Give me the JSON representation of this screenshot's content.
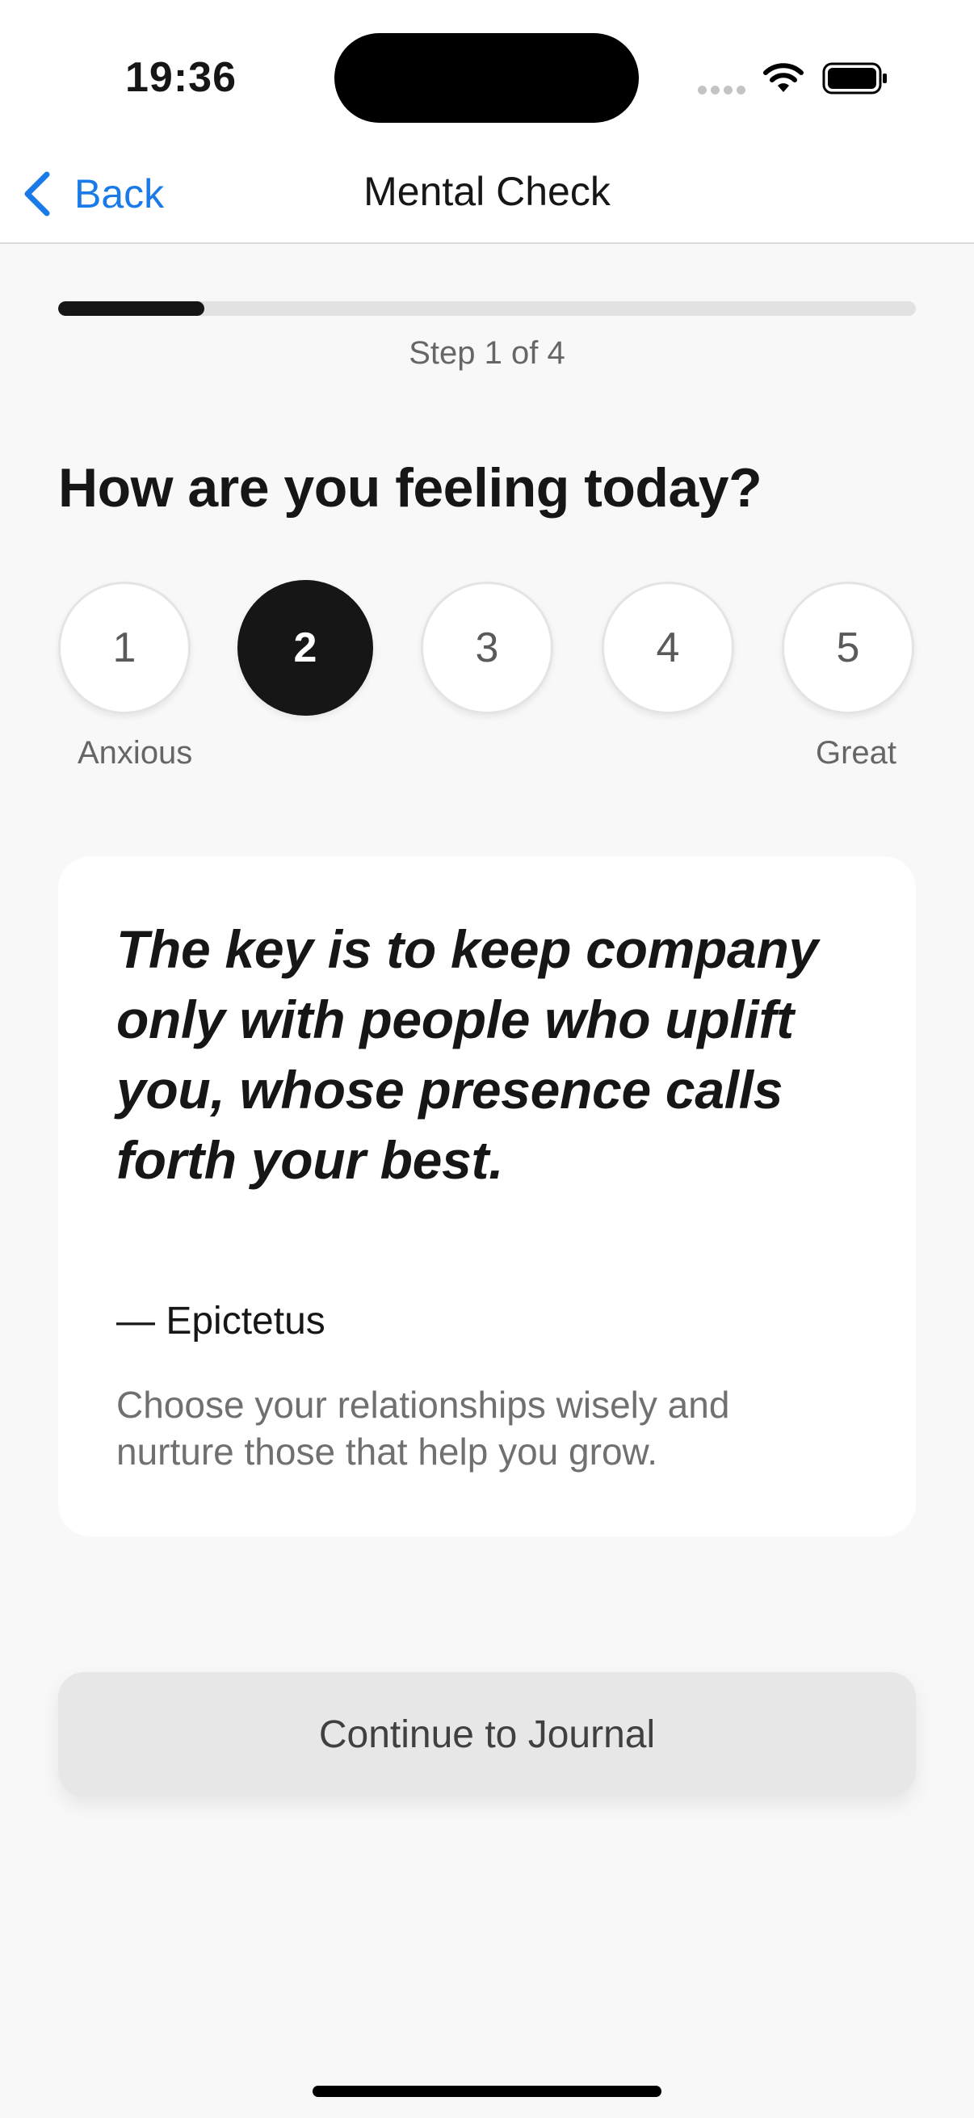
{
  "status_bar": {
    "time": "19:36"
  },
  "nav": {
    "back_label": "Back",
    "title": "Mental Check"
  },
  "progress": {
    "step_text": "Step 1 of 4",
    "fill_fraction": 0.17
  },
  "question": "How are you feeling today?",
  "rating": {
    "options": [
      "1",
      "2",
      "3",
      "4",
      "5"
    ],
    "selected": "2",
    "low_label": "Anxious",
    "high_label": "Great"
  },
  "quote": {
    "text": "The key is to keep company only with people who uplift you, whose presence calls forth your best.",
    "author": "— Epictetus",
    "note": "Choose your relationships wisely and nurture those that help you grow."
  },
  "continue_label": "Continue to Journal",
  "colors": {
    "accent": "#1a7be8",
    "selected": "#161616",
    "background": "#f8f8f8"
  }
}
